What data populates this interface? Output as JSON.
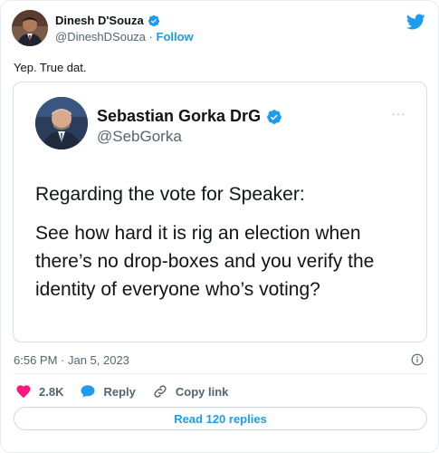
{
  "author": {
    "name": "Dinesh D'Souza",
    "handle": "@DineshDSouza",
    "separator": "·",
    "follow_label": "Follow"
  },
  "tweet": {
    "text": "Yep. True dat.",
    "timestamp": "6:56 PM · Jan 5, 2023"
  },
  "quoted": {
    "name": "Sebastian Gorka DrG",
    "handle": "@SebGorka",
    "more": "···",
    "lines": [
      "Regarding the vote for Speaker:",
      "See how hard it is rig an election when there’s no drop-boxes and you verify the identity of everyone who’s voting?"
    ]
  },
  "actions": {
    "likes": "2.8K",
    "reply_label": "Reply",
    "copy_label": "Copy link"
  },
  "replies_button": "Read 120 replies",
  "colors": {
    "accent": "#1d9bf0",
    "like": "#f91880",
    "muted": "#536471"
  },
  "icons": [
    "verified-badge-icon",
    "twitter-bird-icon",
    "heart-icon",
    "reply-bubble-icon",
    "link-icon",
    "info-icon",
    "more-icon"
  ]
}
